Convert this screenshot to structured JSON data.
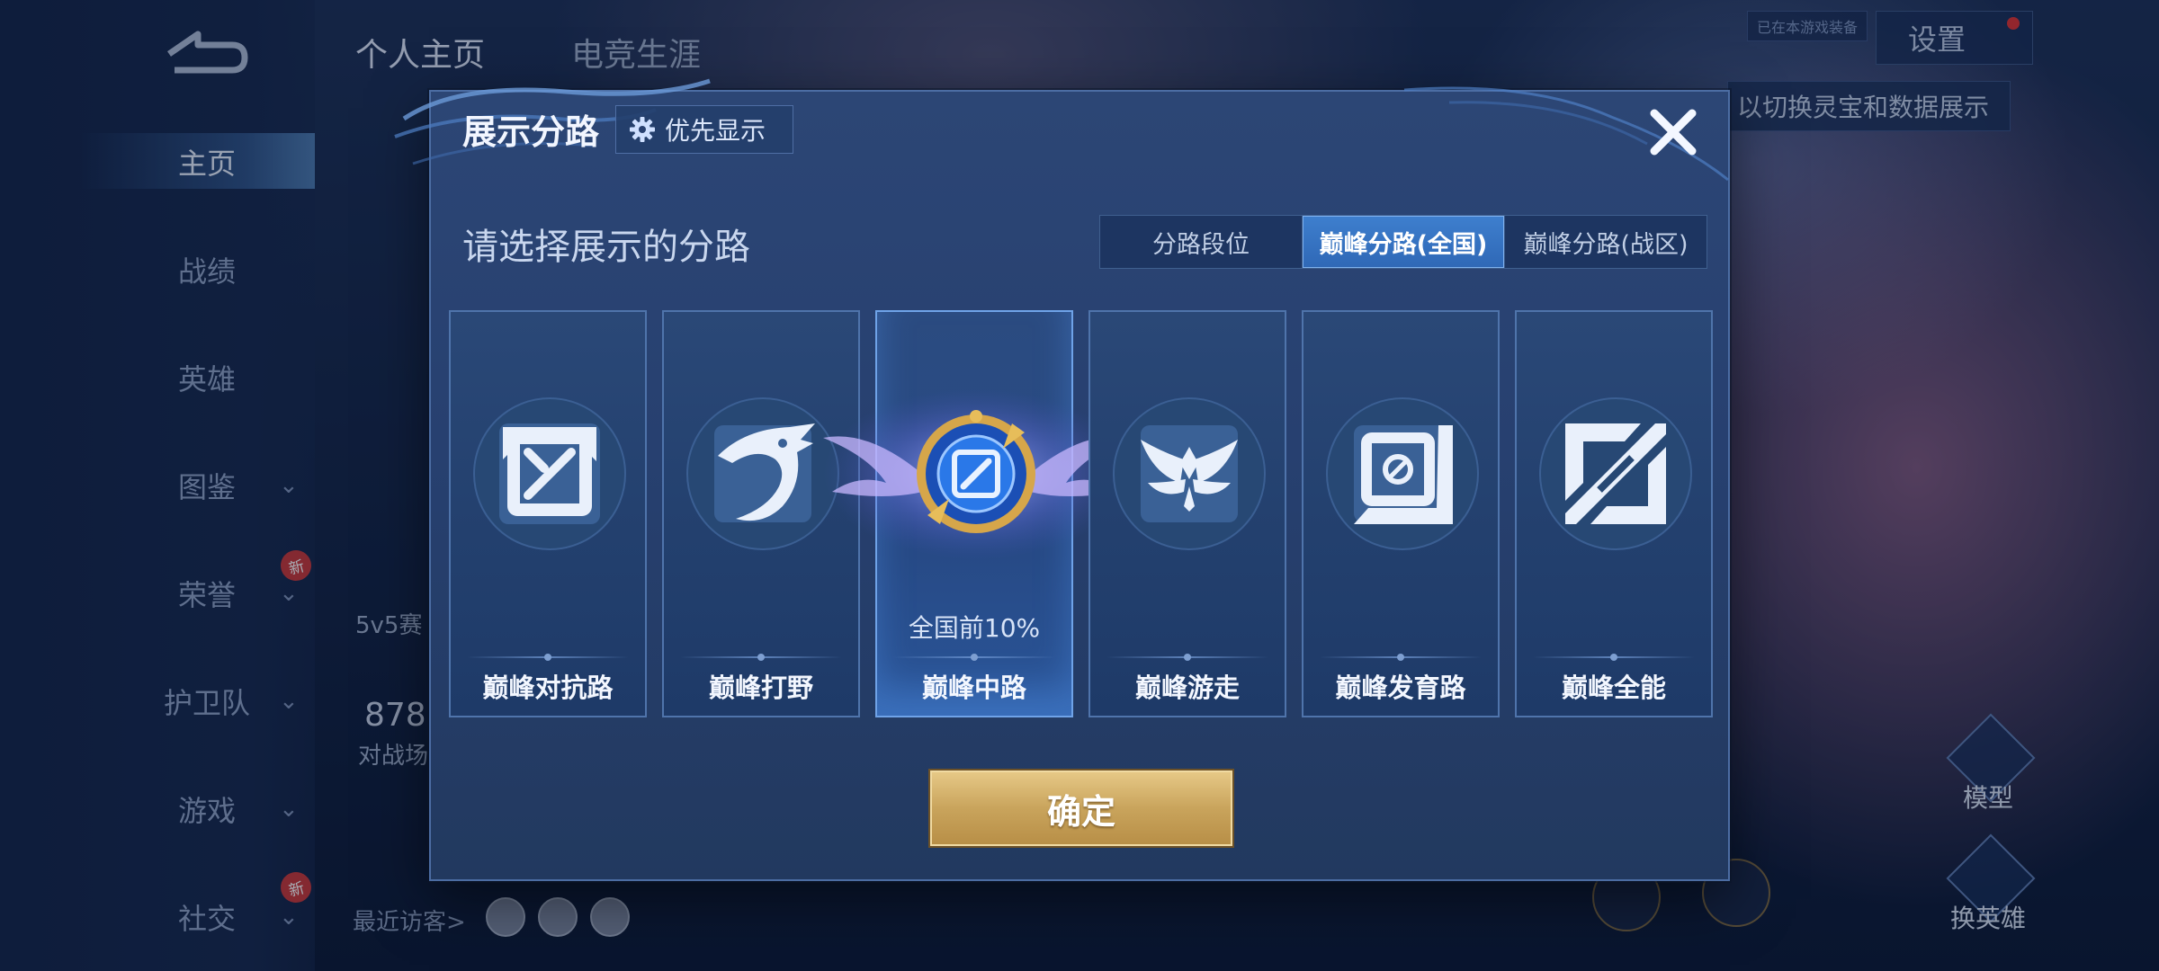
{
  "nav": {
    "items": [
      {
        "label": "主页",
        "active": true,
        "chevron": false,
        "badge": ""
      },
      {
        "label": "战绩",
        "active": false,
        "chevron": false,
        "badge": ""
      },
      {
        "label": "英雄",
        "active": false,
        "chevron": false,
        "badge": ""
      },
      {
        "label": "图鉴",
        "active": false,
        "chevron": true,
        "badge": ""
      },
      {
        "label": "荣誉",
        "active": false,
        "chevron": true,
        "badge": "新"
      },
      {
        "label": "护卫队",
        "active": false,
        "chevron": true,
        "badge": ""
      },
      {
        "label": "游戏",
        "active": false,
        "chevron": true,
        "badge": ""
      },
      {
        "label": "社交",
        "active": false,
        "chevron": true,
        "badge": "新"
      }
    ]
  },
  "top": {
    "tab_profile": "个人主页",
    "tab_esports": "电竞生涯",
    "small_tag": "已在本游戏装备",
    "settings_label": "设置",
    "hint": "以切换灵宝和数据展示"
  },
  "behind": {
    "mode_text": "5v5赛",
    "stat_value": "878",
    "stat_label": "对战场",
    "recent_visitors": "最近访客>",
    "model_label": "模型",
    "switch_hero_label": "换英雄"
  },
  "modal": {
    "title": "展示分路",
    "priority_label": "优先显示",
    "subtitle": "请选择展示的分路",
    "segments": [
      {
        "label": "分路段位",
        "active": false
      },
      {
        "label": "巅峰分路(全国)",
        "active": true
      },
      {
        "label": "巅峰分路(战区)",
        "active": false
      }
    ],
    "lanes": [
      {
        "name": "巅峰对抗路",
        "icon": "sword-cross-icon",
        "rank": "",
        "active": false
      },
      {
        "name": "巅峰打野",
        "icon": "dragon-icon",
        "rank": "",
        "active": false
      },
      {
        "name": "巅峰中路",
        "icon": "mid-lane-emblem-icon",
        "rank": "全国前10%",
        "active": true
      },
      {
        "name": "巅峰游走",
        "icon": "wings-icon",
        "rank": "",
        "active": false
      },
      {
        "name": "巅峰发育路",
        "icon": "carry-lane-icon",
        "rank": "",
        "active": false
      },
      {
        "name": "巅峰全能",
        "icon": "all-round-icon",
        "rank": "",
        "active": false
      }
    ],
    "confirm_label": "确定"
  },
  "colors": {
    "accent_blue": "#3e7fce",
    "gold": "#c9a45c",
    "badge_red": "#c8383a"
  }
}
